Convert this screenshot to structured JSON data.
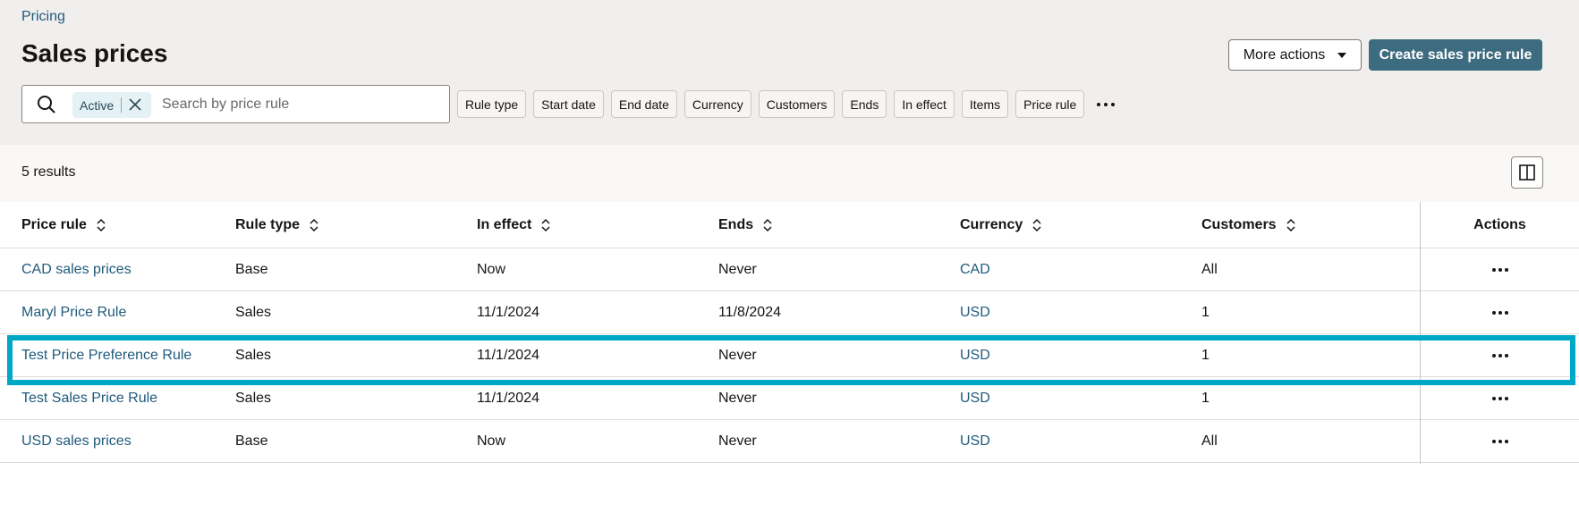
{
  "breadcrumb": "Pricing",
  "page_title": "Sales prices",
  "header_actions": {
    "more_actions_label": "More actions",
    "create_label": "Create sales price rule"
  },
  "search": {
    "active_chip": "Active",
    "placeholder": "Search by price rule",
    "value": ""
  },
  "filters": [
    "Rule type",
    "Start date",
    "End date",
    "Currency",
    "Customers",
    "Ends",
    "In effect",
    "Items",
    "Price rule"
  ],
  "results_count": "5 results",
  "table": {
    "columns": [
      "Price rule",
      "Rule type",
      "In effect",
      "Ends",
      "Currency",
      "Customers",
      "Actions"
    ],
    "rows": [
      {
        "price_rule": "CAD sales prices",
        "rule_type": "Base",
        "in_effect": "Now",
        "ends": "Never",
        "currency": "CAD",
        "customers": "All"
      },
      {
        "price_rule": "Maryl Price Rule",
        "rule_type": "Sales",
        "in_effect": "11/1/2024",
        "ends": "11/8/2024",
        "currency": "USD",
        "customers": "1"
      },
      {
        "price_rule": "Test Price Preference Rule",
        "rule_type": "Sales",
        "in_effect": "11/1/2024",
        "ends": "Never",
        "currency": "USD",
        "customers": "1"
      },
      {
        "price_rule": "Test Sales Price Rule",
        "rule_type": "Sales",
        "in_effect": "11/1/2024",
        "ends": "Never",
        "currency": "USD",
        "customers": "1"
      },
      {
        "price_rule": "USD sales prices",
        "rule_type": "Base",
        "in_effect": "Now",
        "ends": "Never",
        "currency": "USD",
        "customers": "All"
      }
    ]
  },
  "colors": {
    "accent": "#3d6b80",
    "link": "#1f5a7c",
    "highlight": "#00a7c7"
  }
}
